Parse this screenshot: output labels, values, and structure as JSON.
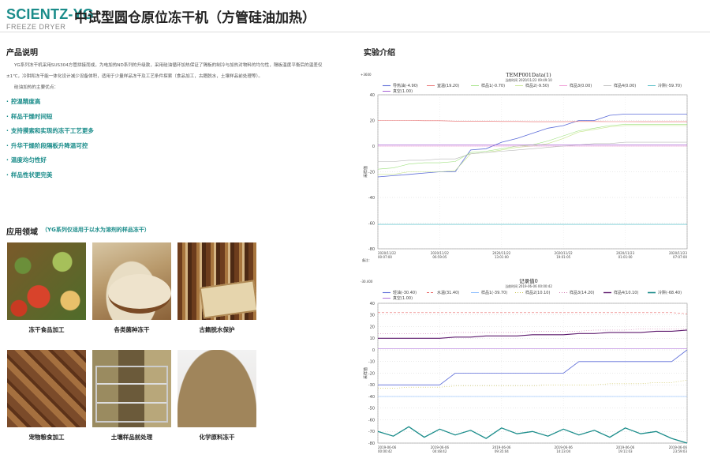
{
  "header": {
    "brand": "SCIENTZ-YG",
    "title": "中试型圆仓原位冻干机（方管硅油加热）",
    "subtitle": "FREEZE DRYER"
  },
  "product": {
    "heading": "产品说明",
    "p1": "YG系列冻干机采用SUS304方管拼接而成，为电加热ND系列的升级款，采用硅油循环加热保证了隔板的制冷与加热对物料的均匀性，隔板温度平衡后的温差仅±1℃，冷阱和冻干能一体化设计减少设备体积，适用于少量样品冻干及工艺条件探索（食品加工，古籍脱水，土壤样品前处理等）。",
    "p2": "硅油加热的主要优点：",
    "features": [
      "控温精度高",
      "样品干燥时间短",
      "支持摸索和实现的冻干工艺更多",
      "升华干燥阶段隔板升降温可控",
      "温度均匀性好",
      "样品性状更完美"
    ]
  },
  "apps": {
    "heading": "应用领域",
    "note": "（YG系列仅适用于以水为溶剂的样品冻干）",
    "items": [
      {
        "label": "冻干食品加工"
      },
      {
        "label": "各类菌种冻干"
      },
      {
        "label": "古籍脱水保护"
      },
      {
        "label": "宠物粮食加工"
      },
      {
        "label": "土壤样品前处理"
      },
      {
        "label": "化学原料冻干"
      }
    ]
  },
  "experiment": {
    "heading": "实验介绍"
  },
  "chart_data": [
    {
      "type": "line",
      "title": "TEMP001Data(1)",
      "subtitle": "当前时间 2020/11/22 09:49:10",
      "corner_label": "+3600",
      "ylabel": "采样值",
      "footer": "备注：",
      "ylim": [
        -80,
        40
      ],
      "yticks": [
        40,
        20,
        0,
        -20,
        -40,
        -60,
        -80
      ],
      "xtick_labels": [
        [
          "2020/11/22",
          "00:07:00"
        ],
        [
          "2020/11/22",
          "06:59:05"
        ],
        [
          "2020/11/22",
          "13:01:00"
        ],
        [
          "2020/11/22",
          "19:01:05"
        ],
        [
          "2020/11/23",
          "01:01:00"
        ],
        [
          "2020/11/23",
          "07:07:00"
        ]
      ],
      "x_count": 6,
      "grid": true,
      "legend": "top",
      "series": [
        {
          "name": "导热油(-4.90)",
          "color": "#5b6bd8",
          "width": 0.8,
          "values": [
            -24,
            -23,
            -22,
            -21,
            -20,
            -20,
            -3,
            -2,
            3,
            6,
            10,
            14,
            16,
            20,
            20,
            24,
            25,
            25,
            25,
            25,
            25
          ]
        },
        {
          "name": "室温(19.20)",
          "color": "#e86464",
          "width": 0.6,
          "values": [
            20,
            20,
            20,
            19.8,
            19.8,
            19.5,
            19.5,
            19.3,
            19.2,
            19.2,
            19,
            19,
            19,
            19.2,
            19.2,
            19.1,
            19.1,
            19,
            19,
            19,
            19
          ]
        },
        {
          "name": "样品1(-0.70)",
          "color": "#9be07a",
          "width": 0.6,
          "values": [
            -18,
            -17,
            -14,
            -13,
            -13,
            -12,
            -5,
            -4,
            -2,
            0,
            1,
            4,
            8,
            12,
            14,
            16,
            17,
            17,
            17,
            17,
            17
          ]
        },
        {
          "name": "样品2(-9.50)",
          "color": "#c6e58c",
          "width": 0.6,
          "values": [
            -22,
            -22,
            -20,
            -20,
            -20,
            -19,
            -6,
            -5,
            -3,
            -1,
            0,
            2,
            6,
            11,
            13,
            15,
            16,
            16,
            16,
            16,
            16
          ]
        },
        {
          "name": "样品3(0.00)",
          "color": "#f08fd2",
          "width": 0.6,
          "values": [
            0,
            0,
            0,
            0,
            0,
            0,
            0,
            0,
            0,
            0,
            0,
            0,
            0,
            0,
            0,
            0,
            0,
            0,
            0,
            0,
            0
          ]
        },
        {
          "name": "样品4(0.00)",
          "color": "#b8b8b8",
          "width": 0.6,
          "values": [
            -12,
            -12,
            -11,
            -11,
            -10,
            -10,
            -6,
            -5,
            -4,
            -3,
            -2,
            -1,
            0,
            1,
            2,
            2,
            3,
            3,
            3,
            3,
            3
          ]
        },
        {
          "name": "冷阱(-59.70)",
          "color": "#3fb6c0",
          "width": 0.6,
          "values": [
            -61,
            -61,
            -61,
            -61,
            -61,
            -61,
            -61,
            -61,
            -61,
            -61,
            -61,
            -61,
            -61,
            -61,
            -61,
            -61,
            -61,
            -61,
            -61,
            -61,
            -61
          ]
        },
        {
          "name": "真空(1.00)",
          "color": "#9a4fd0",
          "width": 0.6,
          "values": [
            1,
            1,
            1,
            1,
            1,
            1,
            1,
            1,
            1,
            1,
            1,
            1,
            1,
            1,
            1,
            1,
            1,
            1,
            1,
            1,
            1
          ]
        }
      ]
    },
    {
      "type": "line",
      "title": "记录值0",
      "subtitle": "当前时间 2019-06-06 00:00:42",
      "corner_label": "-30.400",
      "ylabel": "采样值",
      "ylim": [
        -80,
        40
      ],
      "yticks": [
        40,
        30,
        20,
        10,
        0,
        -10,
        -20,
        -30,
        -40,
        -50,
        -60,
        -70,
        -80
      ],
      "xtick_labels": [
        [
          "2019-06-06",
          "00:00:42"
        ],
        [
          "2019-06-06",
          "04:48:42"
        ],
        [
          "2019-06-06",
          "09:35:04"
        ],
        [
          "2019-06-06",
          "14:23:04"
        ],
        [
          "2019-06-06",
          "19:11:03"
        ],
        [
          "2019-06-06",
          "23:59:03"
        ]
      ],
      "x_count": 6,
      "grid": true,
      "legend": "top",
      "series": [
        {
          "name": "轻油(-30.40)",
          "color": "#5b6bd8",
          "width": 0.8,
          "values": [
            -30,
            -30,
            -30,
            -30,
            -30,
            -20,
            -20,
            -20,
            -20,
            -20,
            -20,
            -20,
            -20,
            -10,
            -10,
            -10,
            -10,
            -10,
            -10,
            -10,
            0
          ]
        },
        {
          "name": "水温(31.40)",
          "color": "#e86464",
          "width": 0.6,
          "dash": "3,2",
          "values": [
            32,
            32,
            32,
            32,
            32,
            32,
            32,
            32,
            32,
            32,
            32,
            32,
            32,
            32,
            32,
            32,
            32,
            32,
            32,
            32,
            31
          ]
        },
        {
          "name": "样品1(-39.70)",
          "color": "#7db6ff",
          "width": 0.6,
          "values": [
            -40,
            -40,
            -40,
            -40,
            -40,
            -40,
            -40,
            -40,
            -40,
            -40,
            -40,
            -40,
            -40,
            -40,
            -40,
            -40,
            -40,
            -40,
            -40,
            -40,
            -40
          ]
        },
        {
          "name": "样品2(10.10)",
          "color": "#c8c04a",
          "width": 0.6,
          "dash": "1,2",
          "values": [
            -33,
            -33,
            -32,
            -32,
            -32,
            -31,
            -31,
            -31,
            -31,
            -31,
            -31,
            -30,
            -30,
            -30,
            -30,
            -29,
            -29,
            -29,
            -28,
            -28,
            -26
          ]
        },
        {
          "name": "样品3(14.20)",
          "color": "#d07ab0",
          "width": 0.6,
          "dash": "1,2",
          "values": [
            14,
            14,
            14,
            14,
            14,
            15,
            15,
            15,
            15,
            15,
            16,
            16,
            16,
            16,
            17,
            17,
            17,
            18,
            18,
            18,
            18
          ]
        },
        {
          "name": "样品4(10.10)",
          "color": "#5e1a6e",
          "width": 1.1,
          "values": [
            10,
            10,
            10,
            10,
            10,
            11,
            11,
            12,
            12,
            12,
            13,
            13,
            13,
            14,
            14,
            15,
            15,
            15,
            16,
            16,
            17
          ]
        },
        {
          "name": "冷阱(-68.40)",
          "color": "#1a8c8a",
          "width": 1.3,
          "values": [
            -70,
            -74,
            -66,
            -75,
            -68,
            -73,
            -69,
            -76,
            -67,
            -72,
            -70,
            -74,
            -68,
            -73,
            -69,
            -75,
            -67,
            -72,
            -70,
            -76,
            -80
          ]
        },
        {
          "name": "真空(1.00)",
          "color": "#9a4fd0",
          "width": 0.5,
          "values": [
            1,
            1,
            1,
            1,
            1,
            1,
            1,
            1,
            1,
            1,
            1,
            1,
            1,
            1,
            1,
            1,
            1,
            1,
            1,
            1,
            1
          ]
        }
      ]
    }
  ]
}
